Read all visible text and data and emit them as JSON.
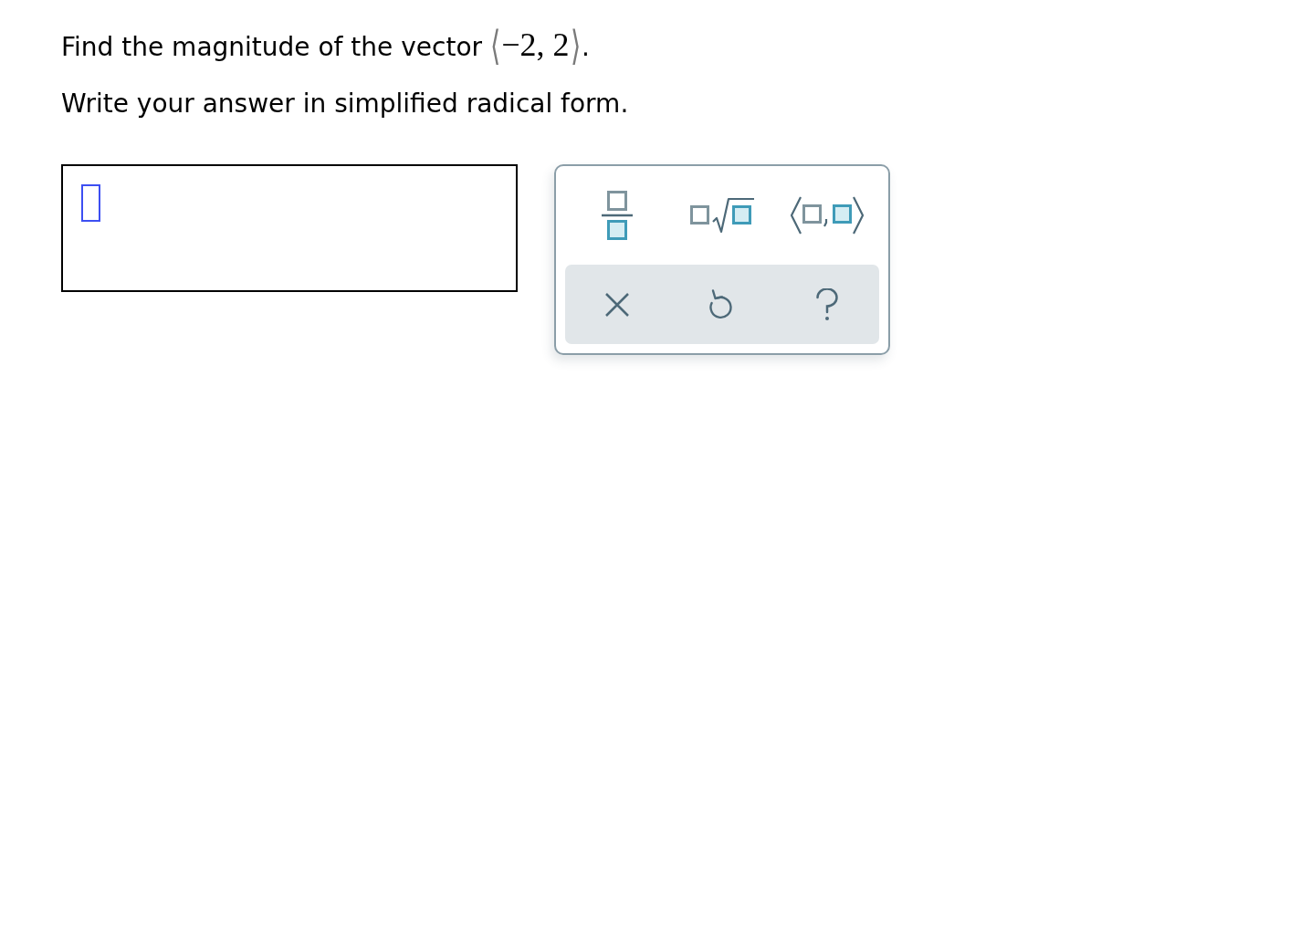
{
  "question": {
    "text": "Find the magnitude of the vector",
    "math": {
      "open": "⟨",
      "body": "−2, 2",
      "close": "⟩"
    },
    "end": "."
  },
  "instruction": "Write your answer in simplified radical form.",
  "answer": {
    "focused": true
  },
  "keypad": {
    "templates": [
      {
        "kind": "fraction"
      },
      {
        "kind": "sqrt"
      },
      {
        "kind": "vector"
      }
    ],
    "actions": [
      {
        "kind": "clear"
      },
      {
        "kind": "undo"
      },
      {
        "kind": "help"
      }
    ]
  }
}
